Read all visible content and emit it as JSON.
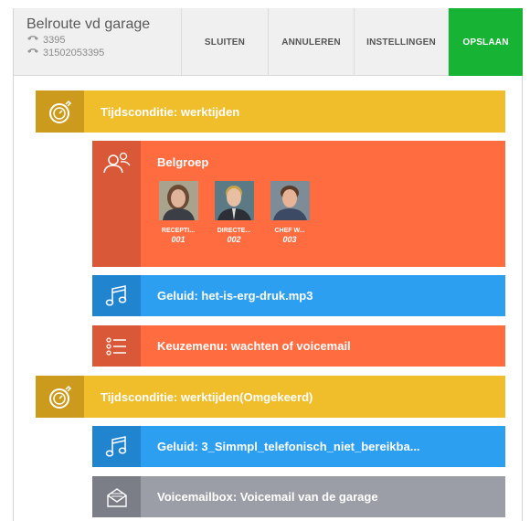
{
  "header": {
    "title": "Belroute vd garage",
    "number1": "3395",
    "number2": "31502053395",
    "buttons": {
      "close": "SLUITEN",
      "cancel": "ANNULEREN",
      "settings": "INSTELLINGEN",
      "save": "OPSLAAN"
    },
    "save_color": "#16b334"
  },
  "flow": {
    "time1": "Tijdsconditie: werktijden",
    "ringgroup": {
      "title": "Belgroep",
      "members": [
        {
          "name": "RECEPTI...",
          "number": "001"
        },
        {
          "name": "DIRECTE...",
          "number": "002"
        },
        {
          "name": "CHEF W...",
          "number": "003"
        }
      ]
    },
    "sound1": "Geluid: het-is-erg-druk.mp3",
    "menu": "Keuzemenu: wachten of voicemail",
    "time2": "Tijdsconditie: werktijden(Omgekeerd)",
    "sound2": "Geluid: 3_Simmpl_telefonisch_niet_bereikba...",
    "voicemail": "Voicemailbox: Voicemail van de garage"
  },
  "colors": {
    "time": "#f0bd2b",
    "ringgroup": "#fe6c40",
    "sound": "#2d9ff0",
    "menu": "#fe6c40",
    "voicemail": "#9b9ea7"
  },
  "icons": [
    "phone-icon",
    "stopwatch-icon",
    "users-icon",
    "music-note-icon",
    "menu-list-icon",
    "voicemail-envelope-icon"
  ]
}
